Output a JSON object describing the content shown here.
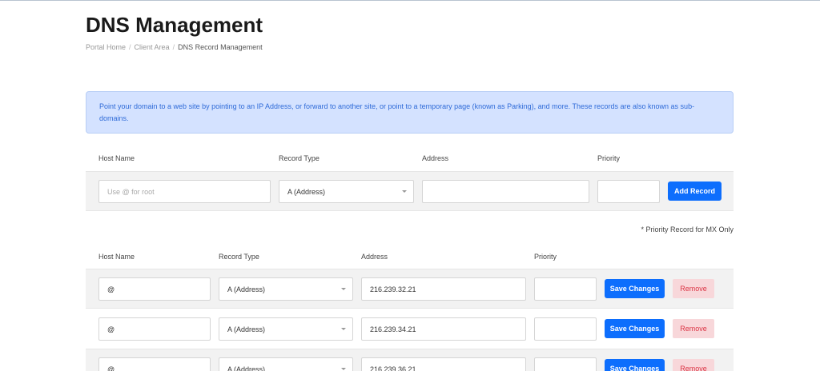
{
  "header": {
    "title": "DNS Management",
    "breadcrumb": [
      "Portal Home",
      "Client Area",
      "DNS Record Management"
    ]
  },
  "info_alert": "Point your domain to a web site by pointing to an IP Address, or forward to another site, or point to a temporary page (known as Parking), and more. These records are also known as sub-domains.",
  "add_form": {
    "headers": {
      "host": "Host Name",
      "type": "Record Type",
      "address": "Address",
      "priority": "Priority"
    },
    "host_placeholder": "Use @ for root",
    "type_value": "A (Address)",
    "address_value": "",
    "priority_value": "",
    "add_button": "Add Record"
  },
  "priority_note": "* Priority Record for MX Only",
  "records_table": {
    "headers": {
      "host": "Host Name",
      "type": "Record Type",
      "address": "Address",
      "priority": "Priority"
    },
    "save_label": "Save Changes",
    "remove_label": "Remove",
    "rows": [
      {
        "host": "@",
        "type": "A (Address)",
        "address": "216.239.32.21",
        "priority": ""
      },
      {
        "host": "@",
        "type": "A (Address)",
        "address": "216.239.34.21",
        "priority": ""
      },
      {
        "host": "@",
        "type": "A (Address)",
        "address": "216.239.36.21",
        "priority": ""
      }
    ]
  },
  "colors": {
    "primary": "#0d6efd",
    "danger": "#dc3545",
    "danger_bg": "#f8d7da",
    "alert_bg": "#d4e2ff",
    "alert_text": "#2f6bd8"
  }
}
